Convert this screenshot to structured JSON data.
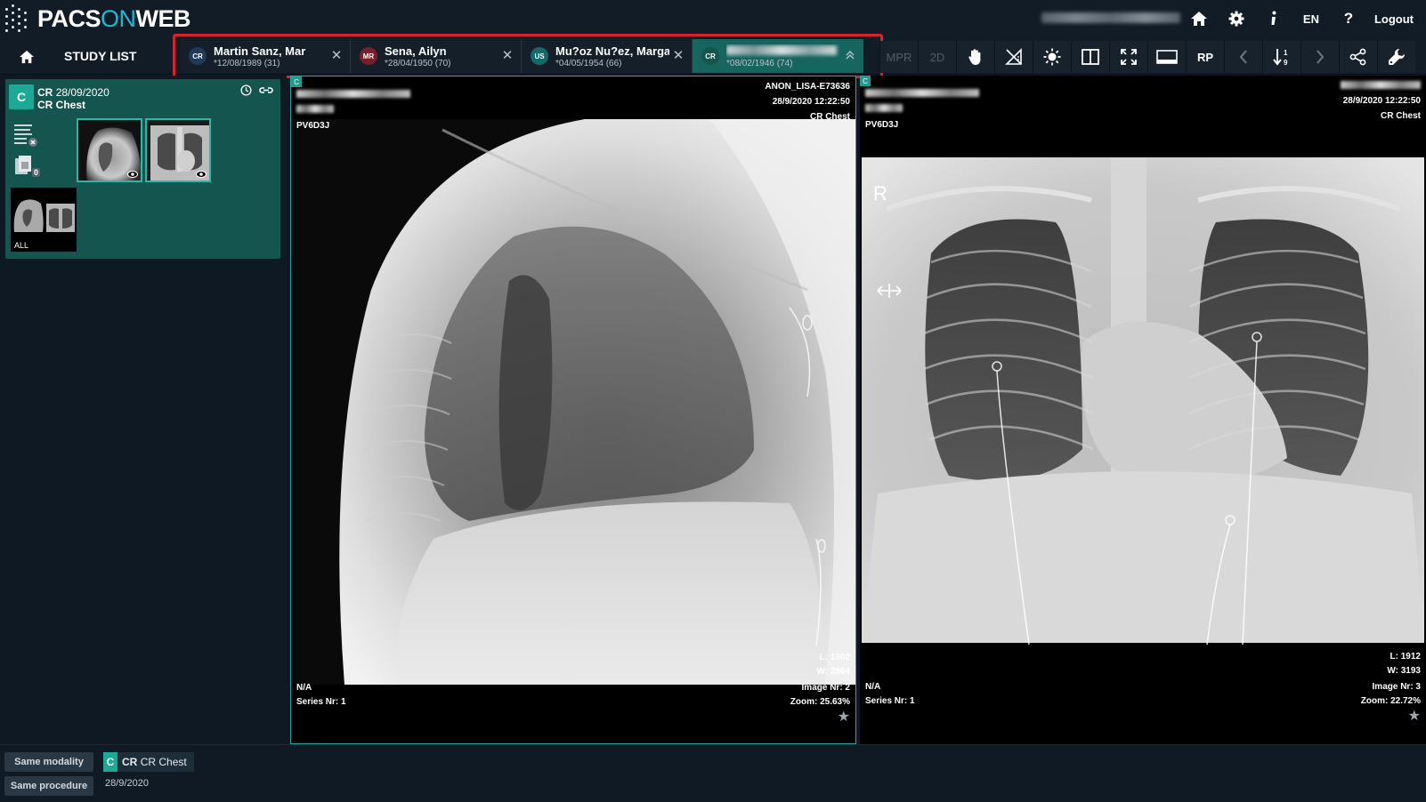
{
  "app": {
    "logo_main": "PACS",
    "logo_on": "ON",
    "logo_tail": "WEB"
  },
  "topbar": {
    "language": "EN",
    "help": "?",
    "logout": "Logout"
  },
  "nav": {
    "study_list": "STUDY LIST"
  },
  "patient_tabs": [
    {
      "modality": "CR",
      "modality_color": "#1f3a57",
      "name": "Martin Sanz, Mar",
      "dob": "*12/08/1989 (31)",
      "active": false
    },
    {
      "modality": "MR",
      "modality_color": "#7a1f2a",
      "name": "Sena, Ailyn",
      "dob": "*28/04/1950 (70)",
      "active": false
    },
    {
      "modality": "US",
      "modality_color": "#136a6a",
      "name": "Mu?oz Nu?ez, Margar",
      "dob": "*04/05/1954 (66)",
      "active": false
    },
    {
      "modality": "CR",
      "modality_color": "#15554f",
      "name": "",
      "dob": "*08/02/1946 (74)",
      "active": true
    }
  ],
  "toolbar": {
    "mpr": "MPR",
    "two_d": "2D",
    "rp": "RP"
  },
  "study_card": {
    "badge": "C",
    "modality": "CR",
    "date": "28/09/2020",
    "description": "CR Chest",
    "all_label": "ALL",
    "keyimage_count": "0"
  },
  "viewport_left": {
    "corner": "C",
    "accession": "ANON_LISA-E73636",
    "datetime": "28/9/2020 12:22:50",
    "study_desc": "CR Chest",
    "station": "PV6D3J",
    "level": "L: 1302",
    "width": "W: 2864",
    "image_nr": "Image Nr: 2",
    "zoom": "Zoom: 25.63%",
    "na": "N/A",
    "series": "Series Nr: 1"
  },
  "viewport_right": {
    "corner": "C",
    "datetime": "28/9/2020 12:22:50",
    "study_desc": "CR Chest",
    "station": "PV6D3J",
    "level": "L: 1912",
    "width": "W: 3193",
    "image_nr": "Image Nr: 3",
    "zoom": "Zoom: 22.72%",
    "na": "N/A",
    "series": "Series Nr: 1",
    "marker": "R"
  },
  "bottom": {
    "same_modality": "Same modality",
    "same_procedure": "Same procedure",
    "related_badge": "C",
    "related_modality": "CR",
    "related_desc": "CR Chest",
    "related_date": "28/9/2020"
  }
}
